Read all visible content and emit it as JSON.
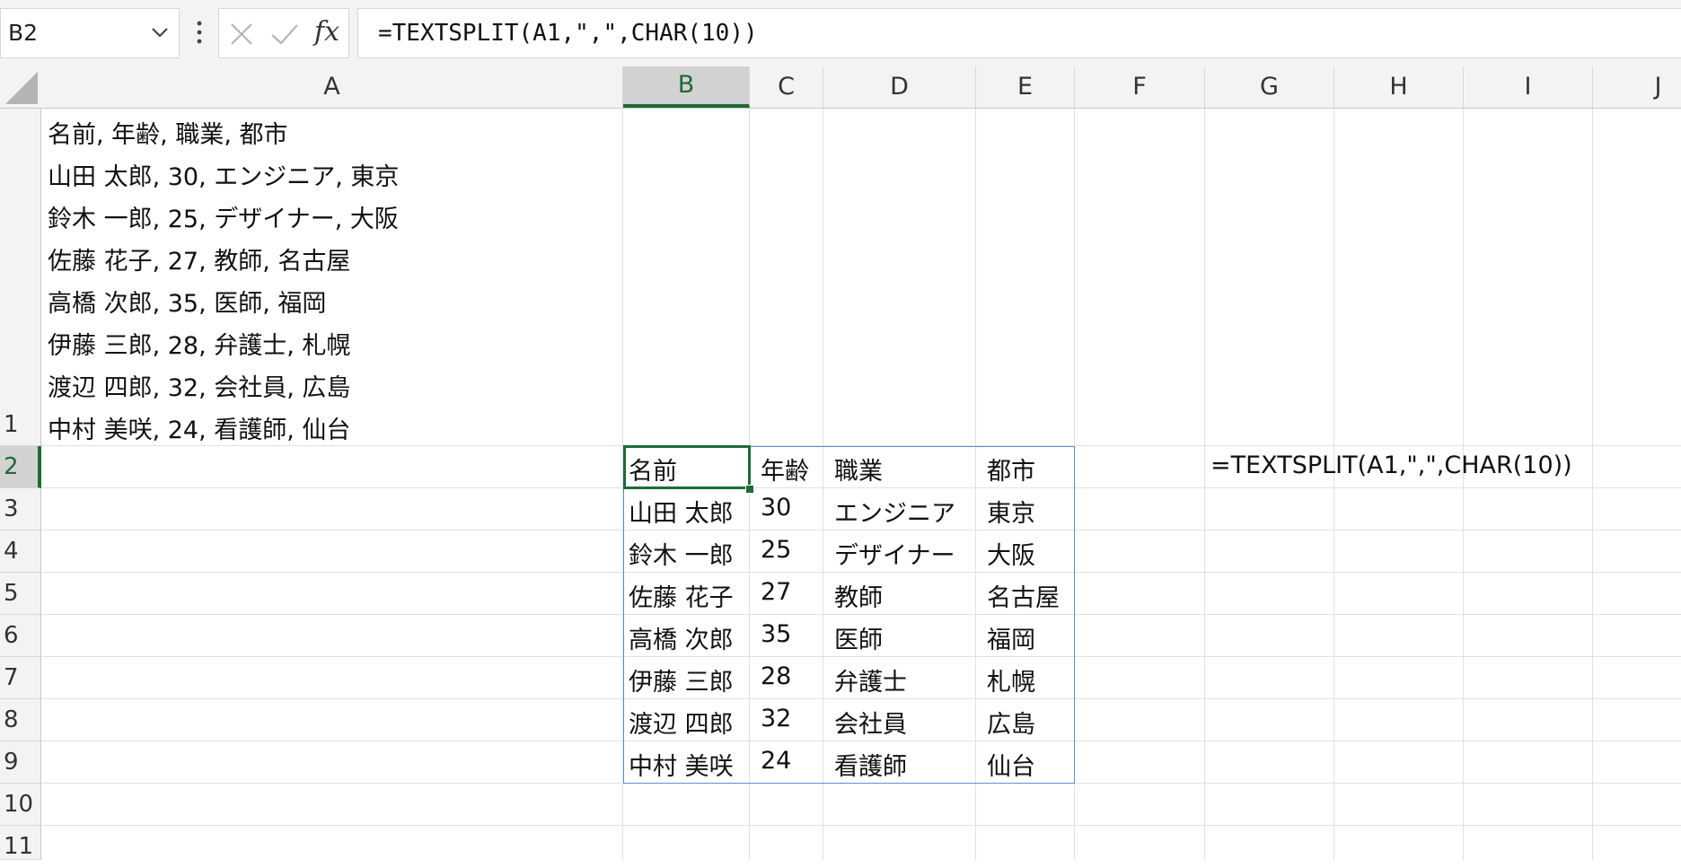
{
  "formula_bar": {
    "name_box": "B2",
    "fx_label": "fx",
    "formula": "=TEXTSPLIT(A1,\",\",CHAR(10))"
  },
  "columns": [
    "A",
    "B",
    "C",
    "D",
    "E",
    "F",
    "G",
    "H",
    "I",
    "J"
  ],
  "active_column": "B",
  "row_numbers": [
    "1",
    "2",
    "3",
    "4",
    "5",
    "6",
    "7",
    "8",
    "9",
    "10",
    "11"
  ],
  "active_row": "2",
  "a1_lines": [
    "名前, 年齢, 職業, 都市",
    "山田 太郎, 30, エンジニア, 東京",
    "鈴木 一郎, 25, デザイナー, 大阪",
    "佐藤 花子, 27, 教師, 名古屋",
    "高橋 次郎, 35, 医師, 福岡",
    "伊藤 三郎, 28, 弁護士, 札幌",
    "渡辺 四郎, 32, 会社員, 広島",
    "中村 美咲, 24, 看護師, 仙台"
  ],
  "spill_table": [
    [
      "名前",
      "年齢",
      "職業",
      "都市"
    ],
    [
      "山田 太郎",
      "30",
      "エンジニア",
      "東京"
    ],
    [
      "鈴木 一郎",
      "25",
      "デザイナー",
      "大阪"
    ],
    [
      "佐藤 花子",
      "27",
      "教師",
      "名古屋"
    ],
    [
      "高橋 次郎",
      "35",
      "医師",
      "福岡"
    ],
    [
      "伊藤 三郎",
      "28",
      "弁護士",
      "札幌"
    ],
    [
      "渡辺 四郎",
      "32",
      "会社員",
      "広島"
    ],
    [
      "中村 美咲",
      "24",
      "看護師",
      "仙台"
    ]
  ],
  "g2_text": "=TEXTSPLIT(A1,\",\",CHAR(10))",
  "colors": {
    "accent_green": "#1e6b36",
    "spill_border_blue": "#5b8fd4"
  },
  "icons": [
    "chevron-down-icon",
    "more-options-icon",
    "cancel-icon",
    "enter-icon"
  ]
}
